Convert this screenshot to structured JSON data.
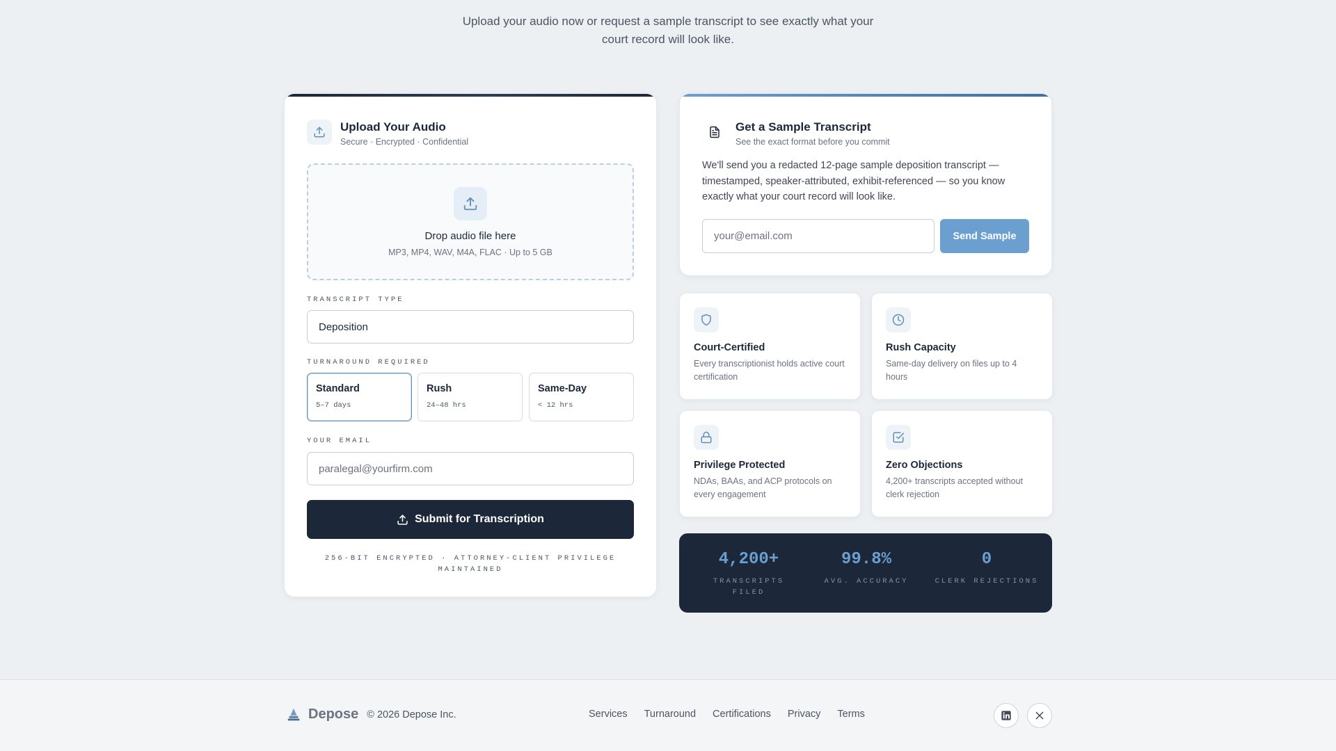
{
  "intro": {
    "line1": "Upload your audio now or request a sample transcript to see exactly what your",
    "line2": "court record will look like."
  },
  "upload": {
    "title": "Upload Your Audio",
    "subtitle": "Secure · Encrypted · Confidential",
    "dropzone_title": "Drop audio file here",
    "dropzone_sub": "MP3, MP4, WAV, M4A, FLAC · Up to 5 GB",
    "transcript_type_label": "TRANSCRIPT TYPE",
    "transcript_type_value": "Deposition",
    "turnaround_label": "TURNAROUND REQUIRED",
    "turnaround_options": [
      {
        "name": "Standard",
        "time": "5–7 days",
        "selected": true
      },
      {
        "name": "Rush",
        "time": "24–48 hrs",
        "selected": false
      },
      {
        "name": "Same-Day",
        "time": "< 12 hrs",
        "selected": false
      }
    ],
    "email_label": "YOUR EMAIL",
    "email_placeholder": "paralegal@yourfirm.com",
    "submit_label": "Submit for Transcription",
    "secure_note": "256-BIT ENCRYPTED · ATTORNEY-CLIENT PRIVILEGE MAINTAINED"
  },
  "sample": {
    "title": "Get a Sample Transcript",
    "subtitle": "See the exact format before you commit",
    "description": "We'll send you a redacted 12-page sample deposition transcript — timestamped, speaker-attributed, exhibit-referenced — so you know exactly what your court record will look like.",
    "email_placeholder": "your@email.com",
    "send_label": "Send Sample"
  },
  "features": [
    {
      "icon": "shield-icon",
      "title": "Court-Certified",
      "desc": "Every transcriptionist holds active court certification"
    },
    {
      "icon": "clock-icon",
      "title": "Rush Capacity",
      "desc": "Same-day delivery on files up to 4 hours"
    },
    {
      "icon": "lock-icon",
      "title": "Privilege Protected",
      "desc": "NDAs, BAAs, and ACP protocols on every engagement"
    },
    {
      "icon": "check-square-icon",
      "title": "Zero Objections",
      "desc": "4,200+ transcripts accepted without clerk rejection"
    }
  ],
  "stats": [
    {
      "value": "4,200+",
      "label": "TRANSCRIPTS FILED"
    },
    {
      "value": "99.8%",
      "label": "AVG. ACCURACY"
    },
    {
      "value": "0",
      "label": "CLERK REJECTIONS"
    }
  ],
  "footer": {
    "brand": "Depose",
    "copyright": "© 2026 Depose Inc.",
    "links": [
      "Services",
      "Turnaround",
      "Certifications",
      "Privacy",
      "Terms"
    ],
    "social": [
      "linkedin-icon",
      "x-icon"
    ]
  },
  "colors": {
    "navy": "#1c2839",
    "accent": "#6a9fd0",
    "background": "#ecf0f3"
  }
}
